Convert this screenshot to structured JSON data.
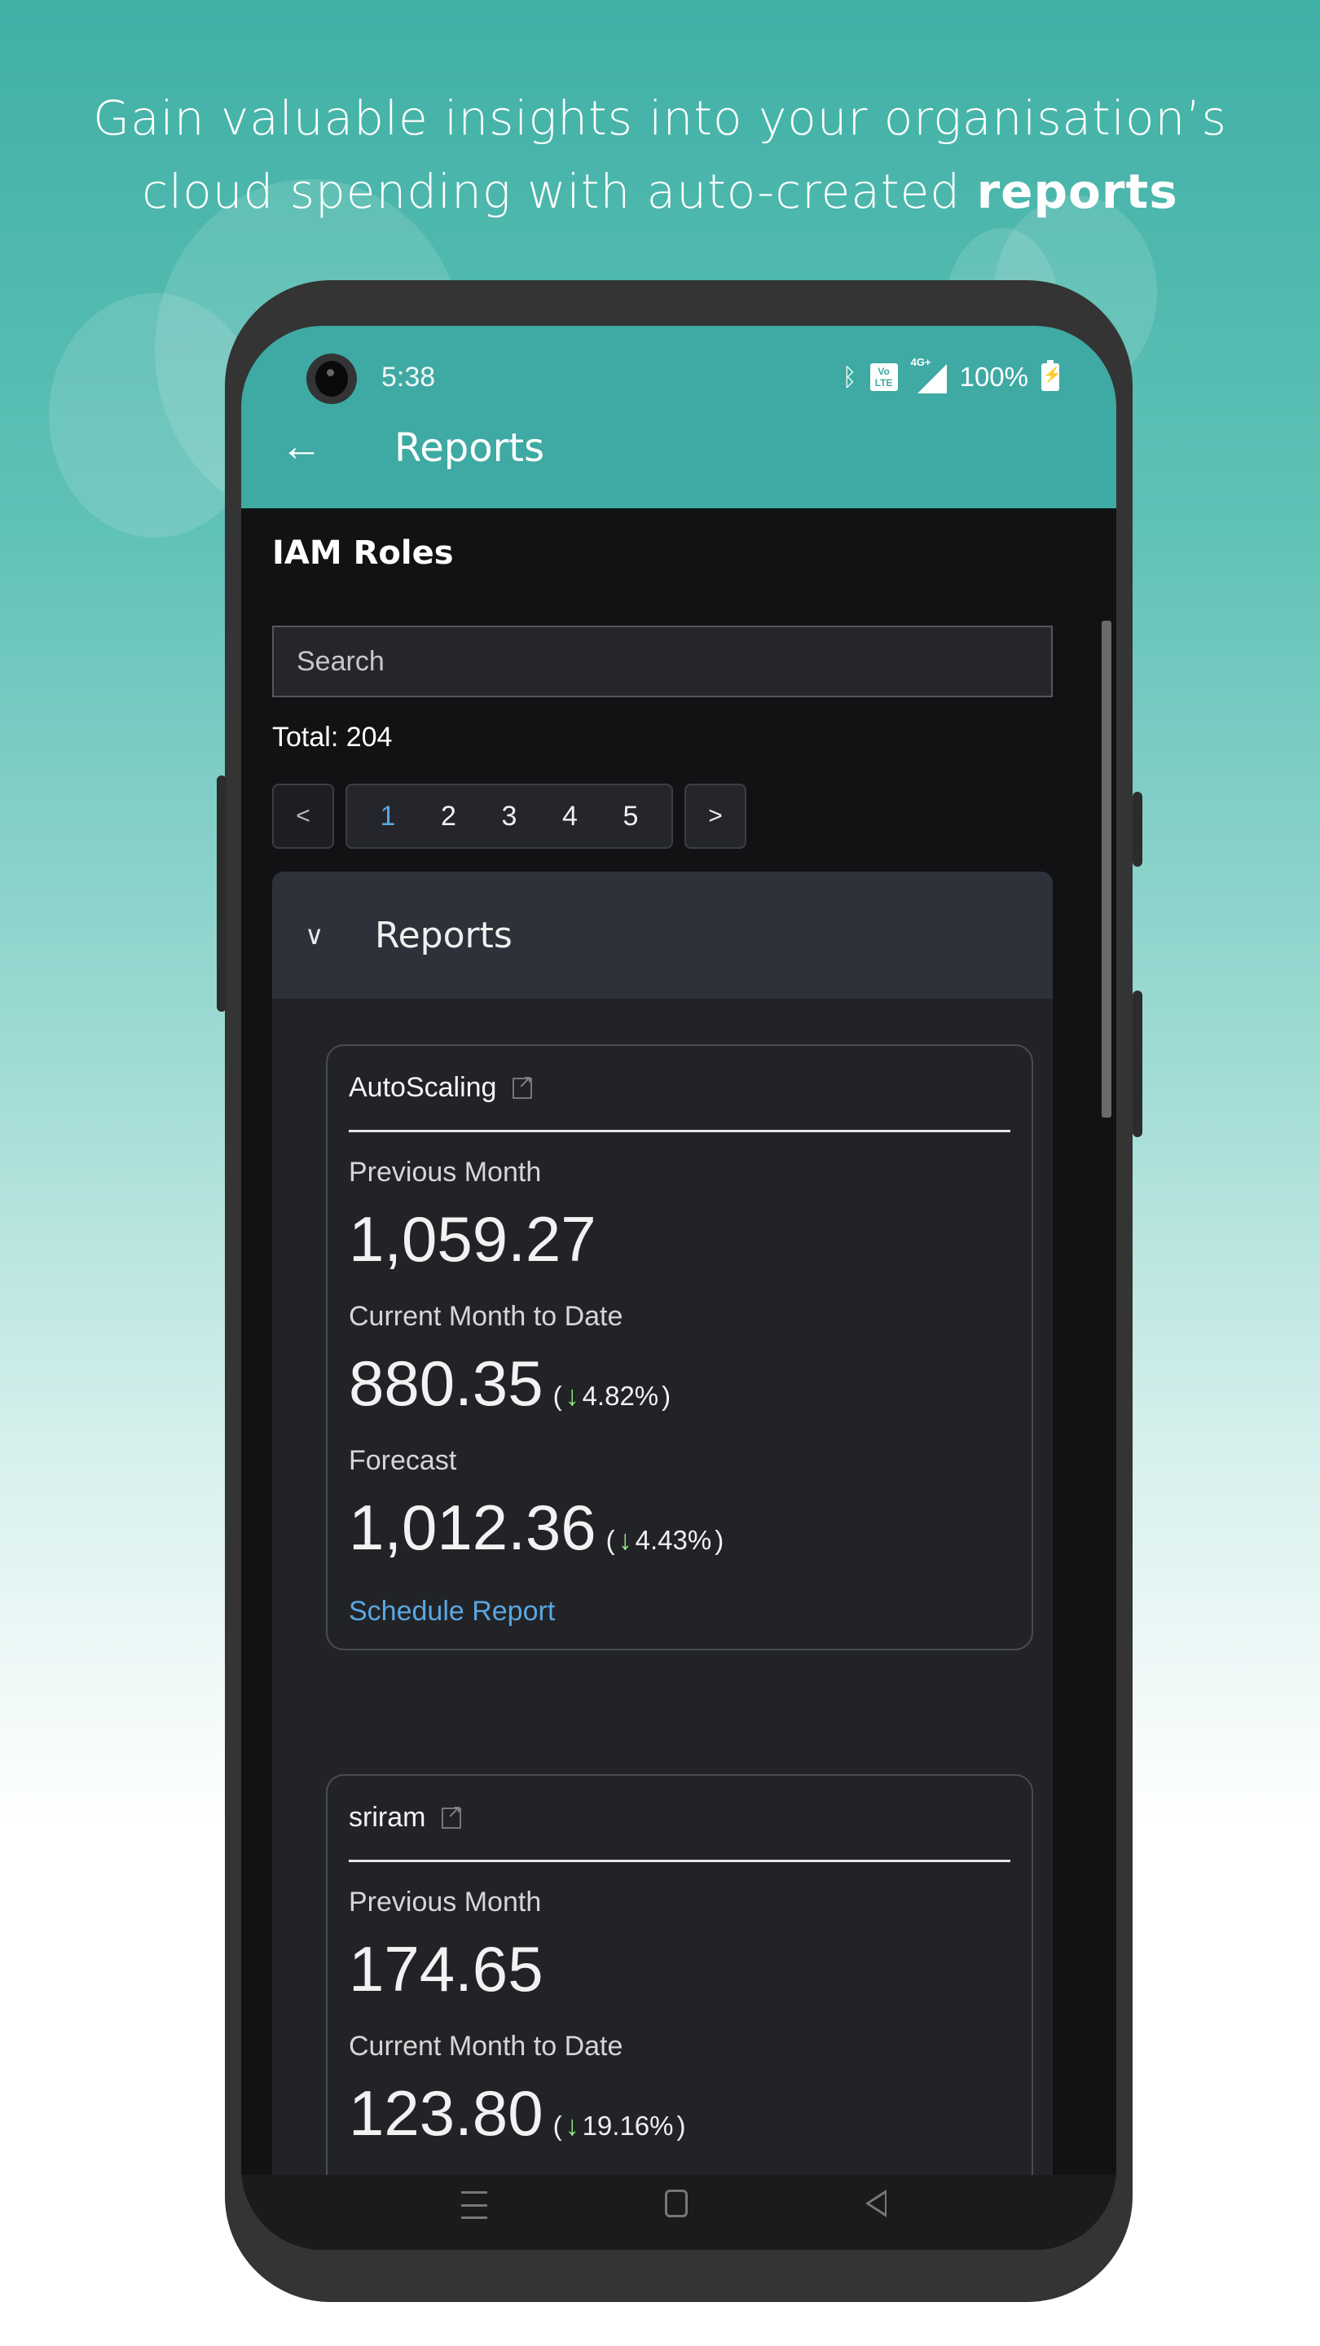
{
  "promo": {
    "headline_line1": "Gain valuable insights into your organisation’s",
    "headline_line2_prefix": "cloud spending with auto-created ",
    "headline_line2_bold": "reports"
  },
  "status_bar": {
    "time": "5:38",
    "icons": [
      "bluetooth-icon",
      "volte-icon",
      "signal-4g-icon",
      "battery-charging-icon"
    ],
    "volte_label": "Vo LTE",
    "network_label": "4G+",
    "battery": "100%"
  },
  "app_bar": {
    "back_icon": "arrow-left-icon",
    "title": "Reports"
  },
  "page": {
    "section_title": "IAM Roles",
    "search": {
      "placeholder": "Search",
      "value": ""
    },
    "total": "Total: 204",
    "pagination": {
      "prev_label": "<",
      "next_label": ">",
      "pages": [
        "1",
        "2",
        "3",
        "4",
        "5"
      ],
      "active_page": "1"
    },
    "accordion": {
      "title": "Reports",
      "expanded": true,
      "cards": [
        {
          "name": "AutoScaling",
          "previous_month_label": "Previous Month",
          "previous_month": "1,059.27",
          "current_month_label": "Current Month to Date",
          "current_month": "880.35",
          "current_change": "4.82%",
          "current_direction": "down",
          "forecast_label": "Forecast",
          "forecast": "1,012.36",
          "forecast_change": "4.43%",
          "forecast_direction": "down",
          "schedule_label": "Schedule Report"
        },
        {
          "name": "sriram",
          "previous_month_label": "Previous Month",
          "previous_month": "174.65",
          "current_month_label": "Current Month to Date",
          "current_month": "123.80",
          "current_change": "19.16%",
          "current_direction": "down"
        }
      ]
    }
  },
  "nav_bar": {
    "buttons": [
      "recents-icon",
      "home-icon",
      "back-icon"
    ]
  },
  "colors": {
    "brand_teal": "#3fa9a3",
    "link_blue": "#5aa7e0",
    "down_green": "#8ff07a",
    "screen_bg": "#111214"
  }
}
